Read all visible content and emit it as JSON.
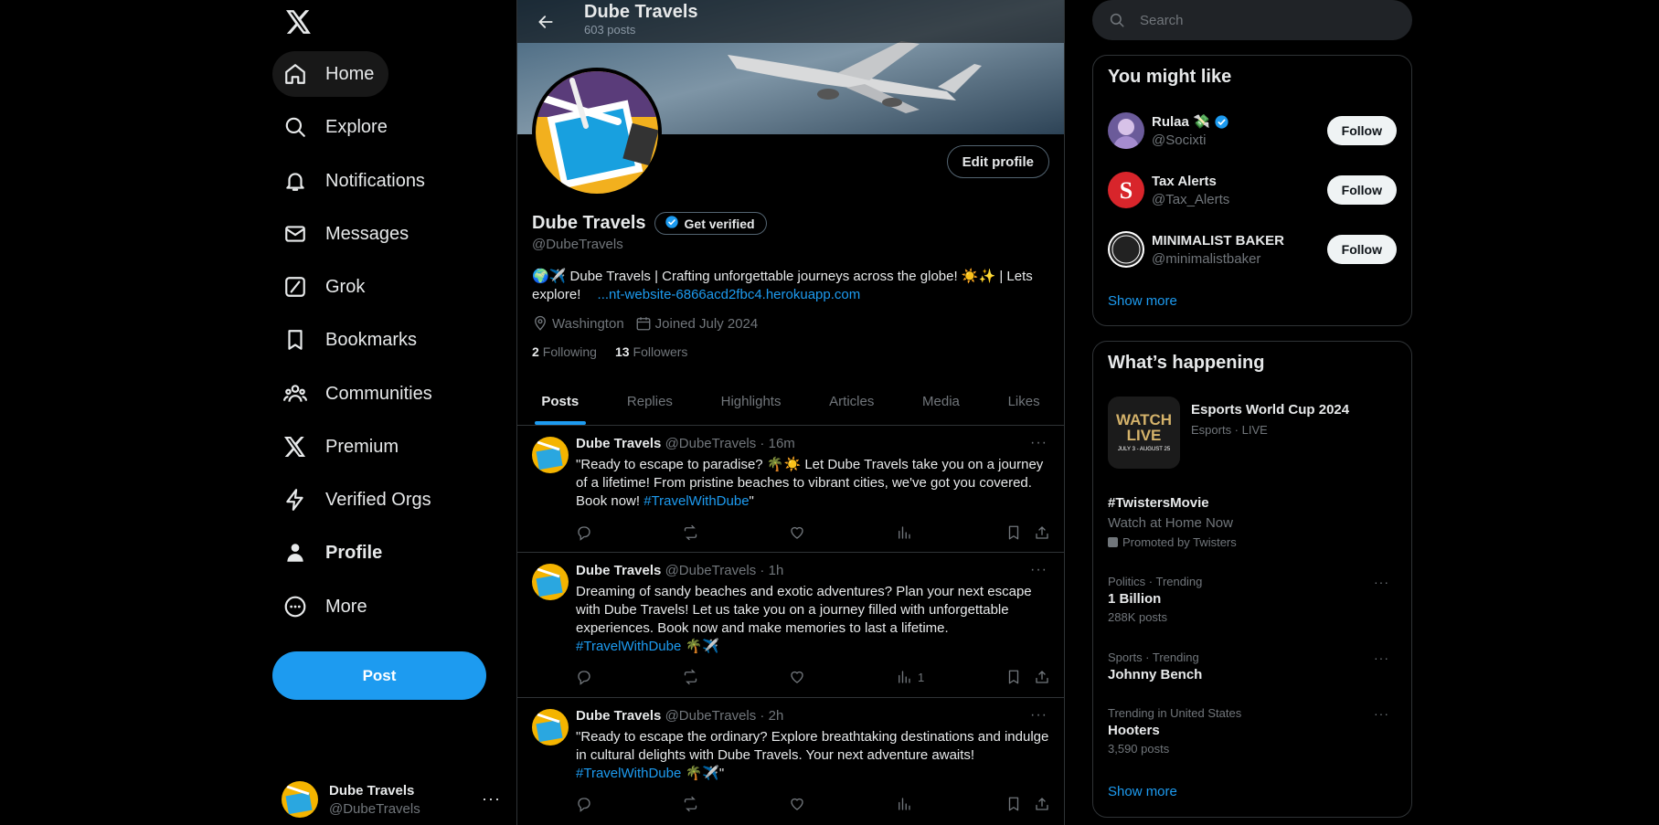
{
  "colors": {
    "accent": "#1d9bf0",
    "background": "#000000",
    "muted": "#71767b",
    "border": "#2f3336"
  },
  "nav": {
    "items": [
      {
        "label": "Home",
        "icon": "home-icon"
      },
      {
        "label": "Explore",
        "icon": "search-icon"
      },
      {
        "label": "Notifications",
        "icon": "bell-icon"
      },
      {
        "label": "Messages",
        "icon": "envelope-icon"
      },
      {
        "label": "Grok",
        "icon": "grok-icon"
      },
      {
        "label": "Bookmarks",
        "icon": "bookmark-icon"
      },
      {
        "label": "Communities",
        "icon": "people-icon"
      },
      {
        "label": "Premium",
        "icon": "x-logo-icon"
      },
      {
        "label": "Verified Orgs",
        "icon": "lightning-icon"
      },
      {
        "label": "Profile",
        "icon": "person-icon"
      },
      {
        "label": "More",
        "icon": "more-circle-icon"
      }
    ],
    "post_label": "Post",
    "account": {
      "name": "Dube Travels",
      "handle": "@DubeTravels"
    }
  },
  "header": {
    "title": "Dube Travels",
    "post_count": "603 posts"
  },
  "profile": {
    "edit_label": "Edit profile",
    "name": "Dube Travels",
    "get_verified": "Get verified",
    "handle": "@DubeTravels",
    "bio": "🌍✈️ Dube Travels | Crafting unforgettable journeys across the globe! ☀️✨ | Lets explore!",
    "bio_link": "...nt-website-6866acd2fbc4.herokuapp.com",
    "location": "Washington",
    "joined": "Joined July 2024",
    "following_count": "2",
    "following_label": "Following",
    "followers_count": "13",
    "followers_label": "Followers"
  },
  "tabs": [
    "Posts",
    "Replies",
    "Highlights",
    "Articles",
    "Media",
    "Likes"
  ],
  "tweets": [
    {
      "name": "Dube Travels",
      "meta": "@DubeTravels · 16m",
      "text": "\"Ready to escape to paradise? 🌴☀️ Let Dube Travels take you on a journey of a lifetime! From pristine beaches to vibrant cities, we've got you covered. Book now! ",
      "hashtag": "#TravelWithDube",
      "tail": "\"",
      "views": ""
    },
    {
      "name": "Dube Travels",
      "meta": "@DubeTravels · 1h",
      "text": "Dreaming of sandy beaches and exotic adventures? Plan your next escape with Dube Travels! Let us take you on a journey filled with unforgettable experiences. Book now and make memories to last a lifetime. ",
      "hashtag": "#TravelWithDube",
      "tail": " 🌴✈️",
      "views": "1"
    },
    {
      "name": "Dube Travels",
      "meta": "@DubeTravels · 2h",
      "text": "\"Ready to escape the ordinary? Explore breathtaking destinations and indulge in cultural delights with Dube Travels. Your next adventure awaits! ",
      "hashtag": "#TravelWithDube",
      "tail": " 🌴✈️\"",
      "views": ""
    }
  ],
  "search": {
    "placeholder": "Search"
  },
  "you_might_like": {
    "title": "You might like",
    "users": [
      {
        "name": "Rulaa 💸",
        "handle": "@Socixti",
        "follow": "Follow",
        "verified": true
      },
      {
        "name": "Tax Alerts",
        "handle": "@Tax_Alerts",
        "follow": "Follow",
        "verified": false
      },
      {
        "name": "MINIMALIST BAKER",
        "handle": "@minimalistbaker",
        "follow": "Follow",
        "verified": false
      }
    ],
    "show_more": "Show more"
  },
  "whats_happening": {
    "title": "What’s happening",
    "featured": {
      "title": "Esports World Cup 2024",
      "context": "Esports · LIVE",
      "thumb_line1": "WATCH",
      "thumb_line2": "LIVE",
      "thumb_dates": "JULY 3 - AUGUST 25"
    },
    "promoted": {
      "title": "#TwistersMovie",
      "desc": "Watch at Home Now",
      "by": "Promoted by Twisters"
    },
    "trends": [
      {
        "context": "Politics · Trending",
        "title": "1 Billion",
        "count": "288K posts"
      },
      {
        "context": "Sports · Trending",
        "title": "Johnny Bench",
        "count": ""
      },
      {
        "context": "Trending in United States",
        "title": "Hooters",
        "count": "3,590 posts"
      }
    ],
    "show_more": "Show more"
  }
}
